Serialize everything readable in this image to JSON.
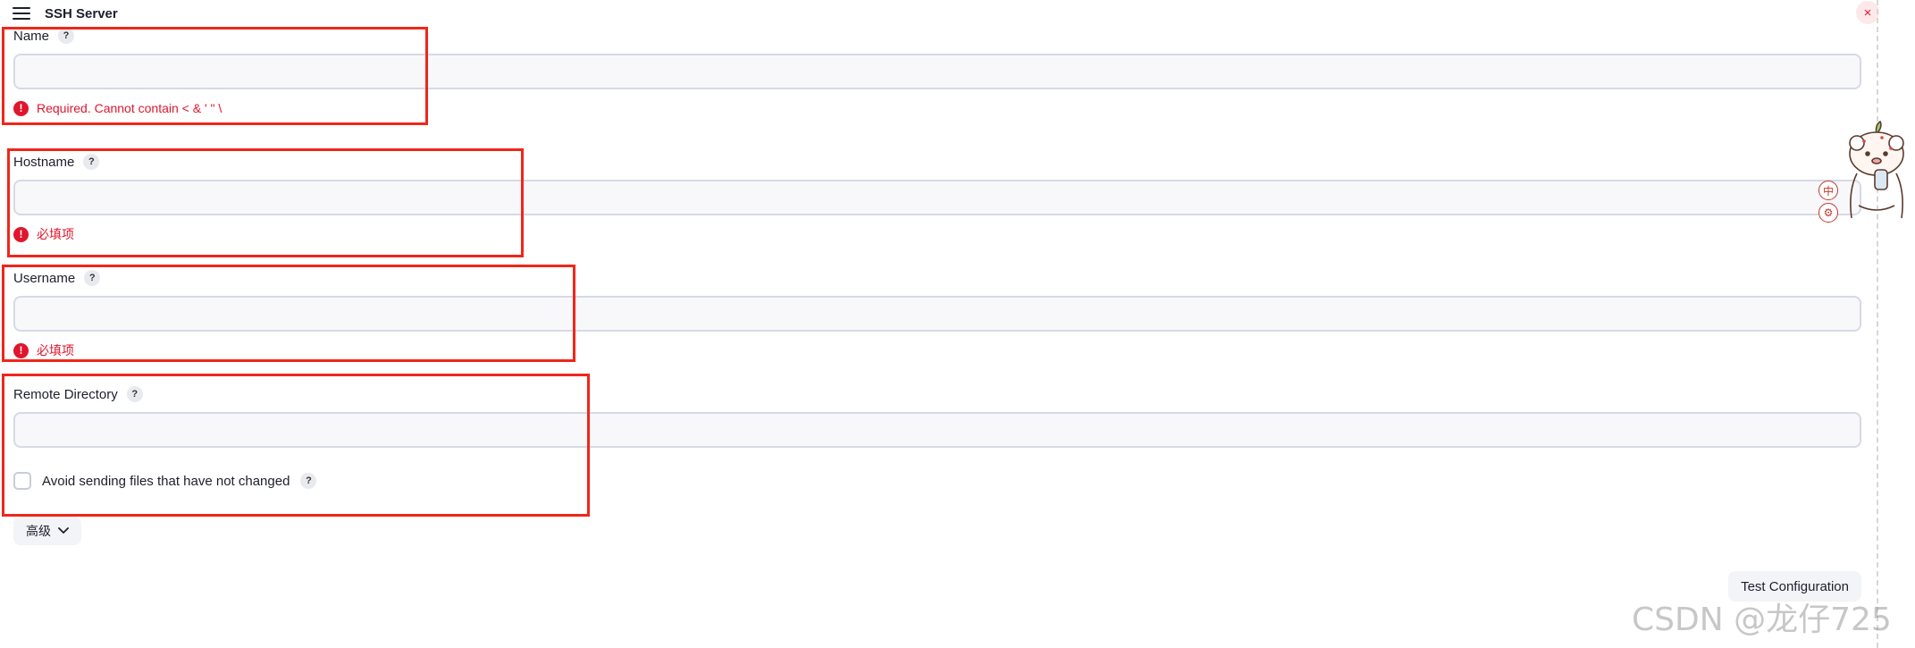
{
  "header": {
    "title": "SSH Server",
    "close_symbol": "×"
  },
  "fields": {
    "name": {
      "label": "Name",
      "value": "",
      "error": "Required. Cannot contain < & ' \" \\"
    },
    "hostname": {
      "label": "Hostname",
      "value": "",
      "error": "必填项"
    },
    "username": {
      "label": "Username",
      "value": "",
      "error": "必填项"
    },
    "remote_directory": {
      "label": "Remote Directory",
      "value": ""
    }
  },
  "help_symbol": "?",
  "error_symbol": "!",
  "checkbox": {
    "label": "Avoid sending files that have not changed",
    "checked": false
  },
  "advanced_button": {
    "label": "高级"
  },
  "test_button": {
    "label": "Test Configuration"
  },
  "side_icons": {
    "language": "中",
    "settings": "⚙"
  },
  "watermark": "CSDN @龙仔725",
  "colors": {
    "error": "#e0162c",
    "highlight": "#f0261b",
    "input_border": "#d6d9e6"
  }
}
